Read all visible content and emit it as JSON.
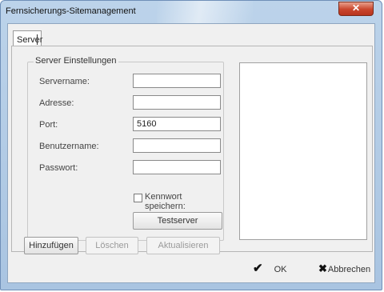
{
  "window": {
    "title": "Fernsicherungs-Sitemanagement",
    "close_glyph": "✕"
  },
  "tabs": [
    {
      "label": "Server"
    }
  ],
  "server_settings": {
    "group_title": "Server Einstellungen",
    "fields": {
      "servername": {
        "label": "Servername:",
        "value": ""
      },
      "adresse": {
        "label": "Adresse:",
        "value": ""
      },
      "port": {
        "label": "Port:",
        "value": "5160"
      },
      "benutzername": {
        "label": "Benutzername:",
        "value": ""
      },
      "passwort": {
        "label": "Passwort:",
        "value": ""
      }
    },
    "remember_password": {
      "label": "Kennwort speichern:",
      "checked": false
    },
    "test_button": "Testserver"
  },
  "actions": {
    "add": "Hinzufügen",
    "delete": "Löschen",
    "refresh": "Aktualisieren"
  },
  "footer": {
    "ok_label": "OK",
    "ok_icon": "✔",
    "cancel_label": "Abbrechen",
    "cancel_icon": "✖"
  },
  "colors": {
    "titlebar": "#bcd3ea",
    "close_button": "#c9452c",
    "client_bg": "#f0f0f0"
  }
}
